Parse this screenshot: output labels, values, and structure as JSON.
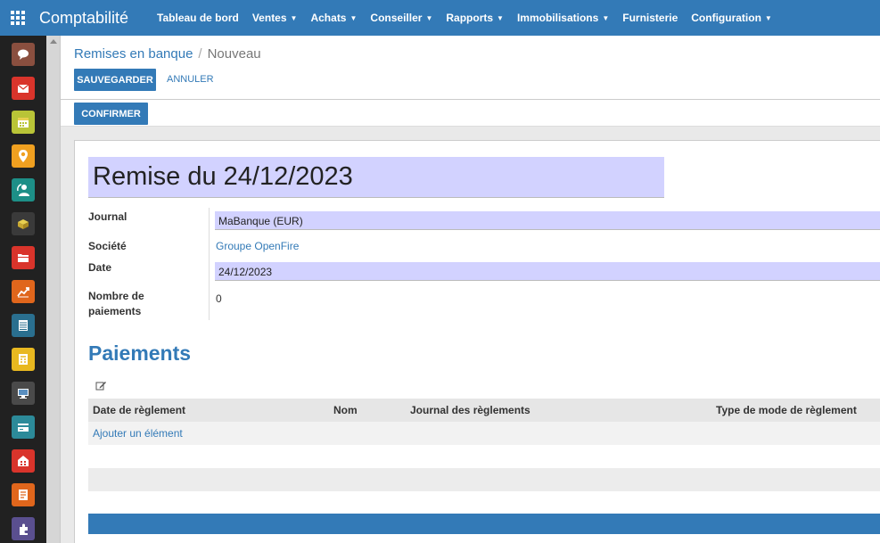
{
  "app": {
    "title": "Comptabilité"
  },
  "menu": [
    {
      "label": "Tableau de bord",
      "dropdown": false
    },
    {
      "label": "Ventes",
      "dropdown": true
    },
    {
      "label": "Achats",
      "dropdown": true
    },
    {
      "label": "Conseiller",
      "dropdown": true
    },
    {
      "label": "Rapports",
      "dropdown": true
    },
    {
      "label": "Immobilisations",
      "dropdown": true
    },
    {
      "label": "Furnisterie",
      "dropdown": false
    },
    {
      "label": "Configuration",
      "dropdown": true
    }
  ],
  "sidebar_apps": [
    {
      "icon": "discuss-icon",
      "color": "#8a4f3f"
    },
    {
      "icon": "mail-icon",
      "color": "#d9342b"
    },
    {
      "icon": "calendar-icon",
      "color": "#b9c437"
    },
    {
      "icon": "crm-icon",
      "color": "#f0a020"
    },
    {
      "icon": "contacts-icon",
      "color": "#1d8f87"
    },
    {
      "icon": "inventory-icon",
      "color": "#3a3a3a"
    },
    {
      "icon": "documents-icon",
      "color": "#d9342b"
    },
    {
      "icon": "accounting-icon",
      "color": "#e0661c"
    },
    {
      "icon": "spreadsheet-icon",
      "color": "#2a6f8f"
    },
    {
      "icon": "invoicing-icon",
      "color": "#e8b820"
    },
    {
      "icon": "pos-icon",
      "color": "#4a4a4a"
    },
    {
      "icon": "expenses-icon",
      "color": "#2c8a99"
    },
    {
      "icon": "buildings-icon",
      "color": "#d9342b"
    },
    {
      "icon": "notes-icon",
      "color": "#e0661c"
    },
    {
      "icon": "apps-icon",
      "color": "#5a4f8f"
    }
  ],
  "breadcrumb": {
    "parent": "Remises en banque",
    "separator": "/",
    "current": "Nouveau"
  },
  "buttons": {
    "save": "SAUVEGARDER",
    "cancel": "ANNULER",
    "confirm": "CONFIRMER"
  },
  "form": {
    "title": "Remise du 24/12/2023",
    "fields": {
      "journal": {
        "label": "Journal",
        "value": "MaBanque (EUR)"
      },
      "company": {
        "label": "Société",
        "value": "Groupe OpenFire"
      },
      "date": {
        "label": "Date",
        "value": "24/12/2023"
      },
      "payment_count": {
        "label_line1": "Nombre de",
        "label_line2": "paiements",
        "value": "0"
      }
    }
  },
  "payments": {
    "title": "Paiements",
    "columns": [
      "Date de règlement",
      "Nom",
      "Journal des règlements",
      "Type de mode de règlement"
    ],
    "add_label": "Ajouter un élément"
  },
  "colors": {
    "primary": "#337ab7",
    "required_field": "#d2d2ff"
  }
}
